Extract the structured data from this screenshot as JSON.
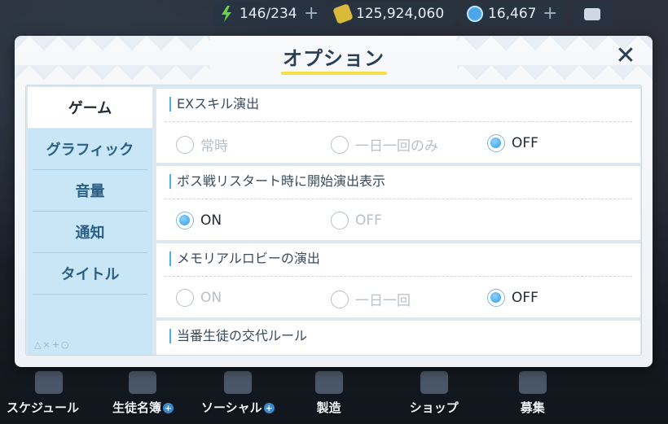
{
  "resources": {
    "ap": "146/234",
    "credits": "125,924,060",
    "gems": "16,467",
    "plus_glyph": "+"
  },
  "bottom_nav": [
    {
      "label": "スケジュール"
    },
    {
      "label": "生徒名簿"
    },
    {
      "label": "ソーシャル"
    },
    {
      "label": "製造"
    },
    {
      "label": "ショップ"
    },
    {
      "label": "募集"
    }
  ],
  "modal": {
    "title": "オプション",
    "close_glyph": "✕"
  },
  "sidebar": {
    "items": [
      {
        "label": "ゲーム",
        "active": true
      },
      {
        "label": "グラフィック",
        "active": false
      },
      {
        "label": "音量",
        "active": false
      },
      {
        "label": "通知",
        "active": false
      },
      {
        "label": "タイトル",
        "active": false
      }
    ],
    "footer": "△×+○"
  },
  "settings": [
    {
      "title": "EXスキル演出",
      "options": [
        {
          "label": "常時",
          "selected": false
        },
        {
          "label": "一日一回のみ",
          "selected": false
        },
        {
          "label": "OFF",
          "selected": true
        }
      ]
    },
    {
      "title": "ボス戦リスタート時に開始演出表示",
      "options": [
        {
          "label": "ON",
          "selected": true
        },
        {
          "label": "OFF",
          "selected": false
        }
      ]
    },
    {
      "title": "メモリアルロビーの演出",
      "options": [
        {
          "label": "ON",
          "selected": false
        },
        {
          "label": "一日一回",
          "selected": false
        },
        {
          "label": "OFF",
          "selected": true
        }
      ]
    },
    {
      "title": "当番生徒の交代ルール",
      "options": []
    }
  ],
  "colors": {
    "accent": "#4ab0e8",
    "title_underline": "#f5e04a",
    "sidebar_bg": "#c8e6f6"
  }
}
